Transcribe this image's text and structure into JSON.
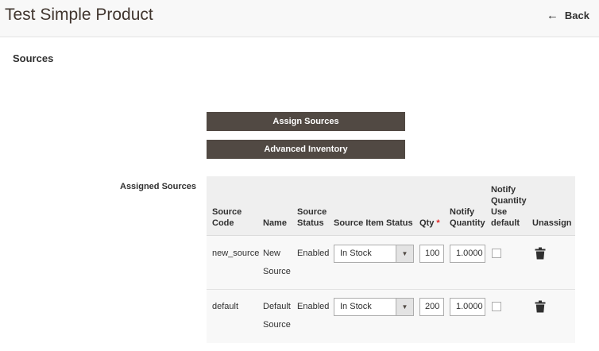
{
  "header": {
    "title": "Test Simple Product",
    "back_label": "Back"
  },
  "section": {
    "title": "Sources"
  },
  "buttons": {
    "assign_sources": "Assign Sources",
    "advanced_inventory": "Advanced Inventory"
  },
  "assigned_sources_label": "Assigned Sources",
  "grid": {
    "columns": {
      "source_code_1": "Source",
      "source_code_2": "Code",
      "name": "Name",
      "source_status_1": "Source",
      "source_status_2": "Status",
      "source_item_status": "Source Item Status",
      "qty": "Qty",
      "qty_required": "*",
      "notify_qty_1": "Notify",
      "notify_qty_2": "Quantity",
      "notify_default_1": "Notify",
      "notify_default_2": "Quantity",
      "notify_default_3": "Use",
      "notify_default_4": "default",
      "unassign": "Unassign"
    },
    "rows": [
      {
        "source_code": "new_source",
        "name_1": "New",
        "name_2": "Source",
        "status": "Enabled",
        "item_status": "In Stock",
        "qty": "100",
        "notify_qty": "1.0000",
        "use_default": false
      },
      {
        "source_code": "default",
        "name_1": "Default",
        "name_2": "Source",
        "status": "Enabled",
        "item_status": "In Stock",
        "qty": "200",
        "notify_qty": "1.0000",
        "use_default": false
      }
    ]
  },
  "icons": {
    "back": "arrow-left-icon",
    "caret": "chevron-down-icon",
    "unassign": "trash-icon"
  },
  "colors": {
    "button_bg": "#514943",
    "required": "#e22626",
    "header_bg": "#f8f8f8"
  }
}
